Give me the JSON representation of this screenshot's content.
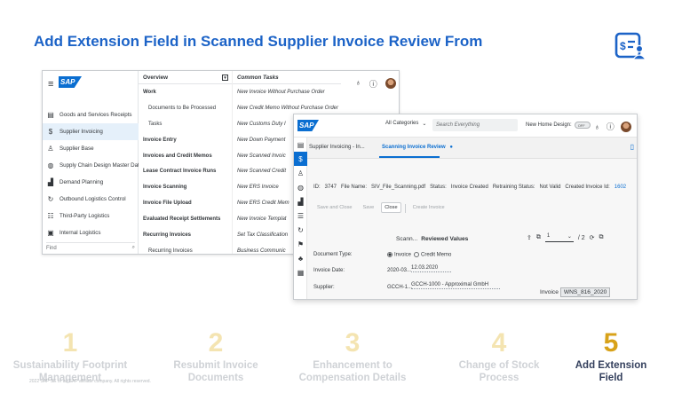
{
  "slide": {
    "title": "Add Extension Field in Scanned Supplier Invoice Review From",
    "icon": "invoice-user-icon",
    "accent": "#1c63c7"
  },
  "window1": {
    "logo": "SAP",
    "nav": [
      {
        "label": "Goods and Services Receipts",
        "icon": "receipt-icon"
      },
      {
        "label": "Supplier Invoicing",
        "icon": "invoice-icon",
        "selected": true
      },
      {
        "label": "Supplier Base",
        "icon": "person-icon"
      },
      {
        "label": "Supply Chain Design Master Data",
        "icon": "globe-icon"
      },
      {
        "label": "Demand Planning",
        "icon": "chart-icon"
      },
      {
        "label": "Outbound Logistics Control",
        "icon": "cycle-icon"
      },
      {
        "label": "Third-Party Logistics",
        "icon": "network-icon"
      },
      {
        "label": "Internal Logistics",
        "icon": "box-icon"
      }
    ],
    "find_placeholder": "Find",
    "overview_header": "Overview",
    "overview_items": [
      {
        "label": "Work",
        "style": "b"
      },
      {
        "label": "Documents to Be Processed",
        "style": "ind"
      },
      {
        "label": "Tasks",
        "style": "ind"
      },
      {
        "label": "Invoice Entry",
        "style": "b"
      },
      {
        "label": "Invoices and Credit Memos",
        "style": "b"
      },
      {
        "label": "Lease Contract Invoice Runs",
        "style": "b"
      },
      {
        "label": "Invoice Scanning",
        "style": "b"
      },
      {
        "label": "Invoice File Upload",
        "style": "b"
      },
      {
        "label": "Evaluated Receipt Settlements",
        "style": "b"
      },
      {
        "label": "Recurring Invoices",
        "style": "b"
      },
      {
        "label": "Recurring Invoices",
        "style": "ind"
      }
    ],
    "tasks_header": "Common Tasks",
    "tasks_items": [
      "New Invoice Without Purchase Order",
      "New Credit Memo Without Purchase Order",
      "New Customs Duty I",
      "New Down Payment",
      "New Scanned Invoic",
      "New Scanned Credit",
      "New ERS Invoice",
      "New ERS Credit Mem",
      "New Invoice Templat",
      "Set Tax Classification",
      "Business Communic"
    ]
  },
  "window2": {
    "logo": "SAP",
    "category": "All Categories",
    "search_placeholder": "Search Everything",
    "new_home_label": "New Home Design:",
    "toggle_label": "OFF",
    "tabs": [
      "Supplier Invoicing - In...",
      "Scanning Invoice Review"
    ],
    "tab_badge": "●",
    "info": {
      "id_label": "ID:",
      "id_value": "3747",
      "file_label": "File Name:",
      "file_value": "SIV_File_Scanning.pdf",
      "status_label": "Status:",
      "status_value": "Invoice Created",
      "retrain_label": "Retraining Status:",
      "retrain_value": "Not Valid",
      "created_label": "Created Invoice Id:",
      "created_value": "1602"
    },
    "actions": [
      "Save and Close",
      "Save",
      "Close",
      "Create Invoice"
    ],
    "review": {
      "scanned": "Scann...",
      "reviewed": "Reviewed Values"
    },
    "pager": {
      "page": "1",
      "total": "/ 2"
    },
    "form": {
      "doc_type_label": "Document Type:",
      "doc_type_invoice": "Invoice",
      "doc_type_credit": "Credit Memo",
      "inv_date_label": "Invoice Date:",
      "inv_date_scanned": "2020-03...",
      "inv_date_value": "12.03.2020",
      "supplier_label": "Supplier:",
      "supplier_scanned": "GCCH-1...",
      "supplier_value": "GCCH-1000 - Approximal GmbH",
      "invoice_label": "Invoice",
      "invoice_value": "WNS_816_2020"
    }
  },
  "steps": [
    {
      "number": "1",
      "label1": "Sustainability Footprint",
      "label2": "Management",
      "state": "faded"
    },
    {
      "number": "2",
      "label1": "Resubmit Invoice",
      "label2": "Documents",
      "state": "faded"
    },
    {
      "number": "3",
      "label1": "Enhancement to",
      "label2": "Compensation Details",
      "state": "faded"
    },
    {
      "number": "4",
      "label1": "Change of Stock",
      "label2": "Process",
      "state": "faded"
    },
    {
      "number": "5",
      "label1": "Add Extension",
      "label2": "Field",
      "state": "active"
    }
  ],
  "copyright": "2022 SAP SE or an SAP affiliate company. All rights reserved."
}
